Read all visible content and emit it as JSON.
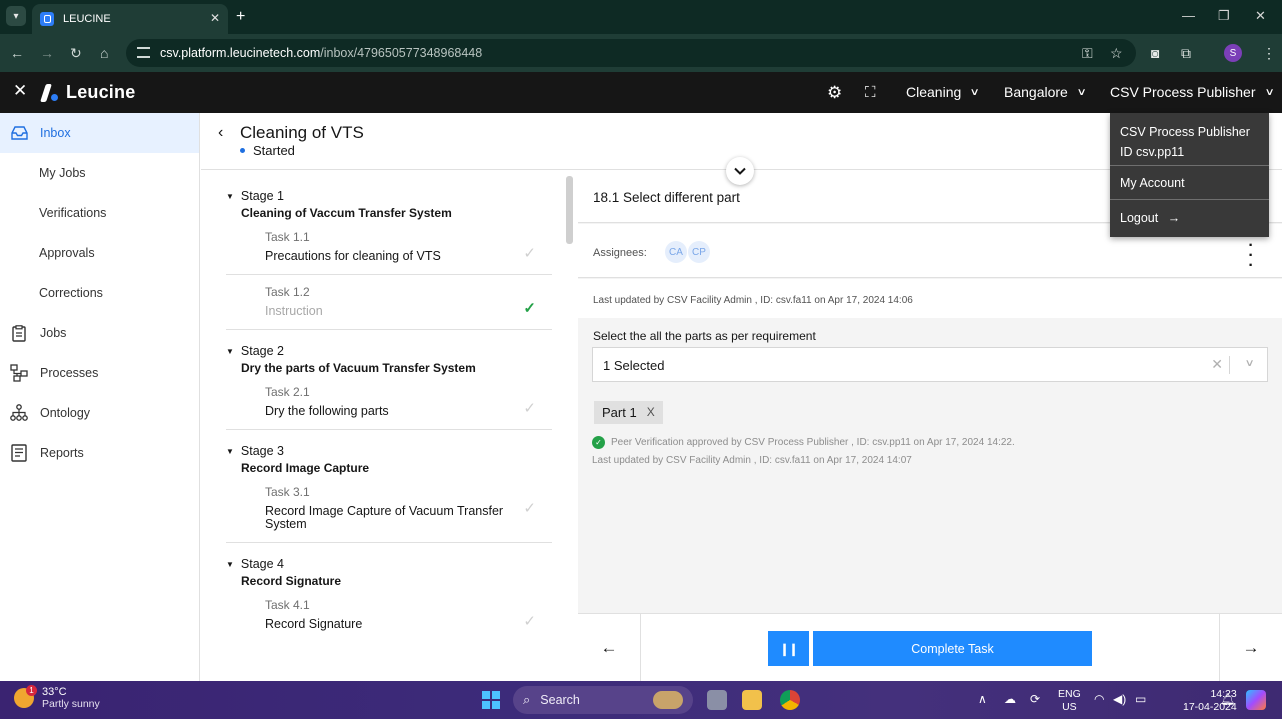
{
  "browser": {
    "tab_title": "LEUCINE",
    "url_host": "csv.platform.leucinetech.com",
    "url_path": "/inbox/479650577348968448",
    "profile_initial": "S"
  },
  "header": {
    "brand": "Leucine",
    "facility_dropdown": "Cleaning",
    "site_dropdown": "Bangalore",
    "user_dropdown": "CSV Process Publisher"
  },
  "account_menu": {
    "name": "CSV Process Publisher",
    "id_line": "ID csv.pp11",
    "my_account": "My Account",
    "logout": "Logout"
  },
  "sidebar": {
    "items": [
      {
        "label": "Inbox",
        "icon": "inbox-icon"
      },
      {
        "label": "My Jobs"
      },
      {
        "label": "Verifications"
      },
      {
        "label": "Approvals"
      },
      {
        "label": "Corrections"
      },
      {
        "label": "Jobs",
        "icon": "jobs-icon"
      },
      {
        "label": "Processes",
        "icon": "processes-icon"
      },
      {
        "label": "Ontology",
        "icon": "ontology-icon"
      },
      {
        "label": "Reports",
        "icon": "reports-icon"
      }
    ]
  },
  "job": {
    "title": "Cleaning of VTS",
    "status": "Started"
  },
  "stages": [
    {
      "label": "Stage 1",
      "name": "Cleaning of Vaccum Transfer System",
      "tasks": [
        {
          "no": "Task 1.1",
          "name": "Precautions for cleaning of VTS",
          "done": false
        },
        {
          "no": "Task 1.2",
          "name": "Instruction",
          "done": true
        }
      ]
    },
    {
      "label": "Stage 2",
      "name": "Dry the parts of Vacuum Transfer System",
      "tasks": [
        {
          "no": "Task 2.1",
          "name": "Dry the following parts",
          "done": false
        }
      ]
    },
    {
      "label": "Stage 3",
      "name": "Record Image Capture",
      "tasks": [
        {
          "no": "Task 3.1",
          "name": "Record Image Capture of Vacuum Transfer System",
          "done": false
        }
      ]
    },
    {
      "label": "Stage 4",
      "name": "Record Signature",
      "tasks": [
        {
          "no": "Task 4.1",
          "name": "Record Signature",
          "done": false
        }
      ]
    }
  ],
  "task": {
    "title": "18.1 Select different part",
    "assignees_label": "Assignees:",
    "assignees": [
      "CA",
      "CP"
    ],
    "last_updated": "Last updated by CSV Facility Admin , ID: csv.fa11 on Apr 17, 2024 14:06",
    "parameter_label": "Select the all the parts as per requirement",
    "select_value": "1 Selected",
    "chip": "Part 1",
    "peer_verification": "Peer Verification approved by CSV Process Publisher , ID: csv.pp11 on Apr 17, 2024 14:22.",
    "param_last_updated": "Last updated by CSV Facility Admin , ID: csv.fa11 on Apr 17, 2024 14:07",
    "complete_label": "Complete Task"
  },
  "taskbar": {
    "temp": "33°C",
    "weather": "Partly sunny",
    "weather_badge": "1",
    "search": "Search",
    "lang1": "ENG",
    "lang2": "US",
    "time": "14:23",
    "date": "17-04-2024"
  },
  "colors": {
    "accent": "#1f8bff",
    "active_bg": "#e7f1ff",
    "header_bg": "#161616",
    "success": "#24a148"
  }
}
